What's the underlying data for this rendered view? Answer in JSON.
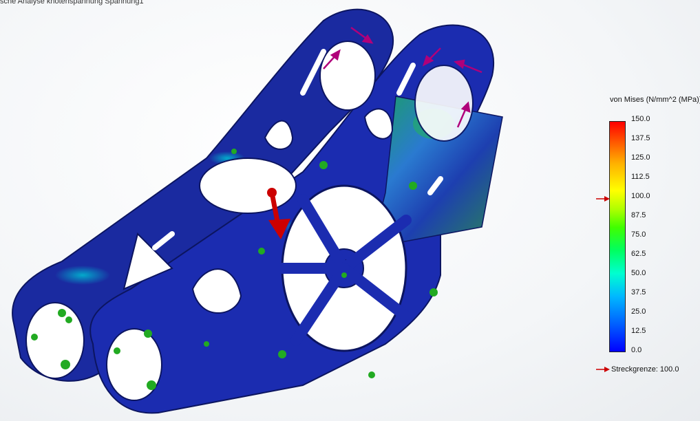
{
  "study_title": "sche Analyse knotenspannung Spannung1",
  "legend": {
    "title": "von Mises (N/mm^2 (MPa))",
    "ticks": [
      "150.0",
      "137.5",
      "125.0",
      "112.5",
      "100.0",
      "87.5",
      "75.0",
      "62.5",
      "50.0",
      "37.5",
      "25.0",
      "12.5",
      "0.0"
    ],
    "yield_label": "Streckgrenze: 100.0",
    "yield_value": 100.0,
    "range": [
      0,
      150
    ]
  },
  "colors": {
    "low": "#0000ff",
    "high": "#ff0000",
    "load_arrow": "#cc0000",
    "fixture": "#22aa22",
    "force": "#b0007a"
  }
}
